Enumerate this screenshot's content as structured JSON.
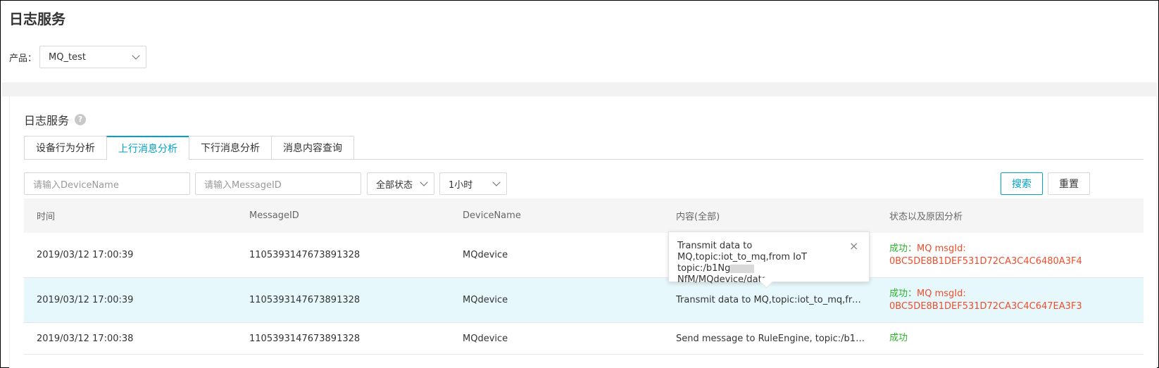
{
  "page": {
    "title": "日志服务"
  },
  "product": {
    "label": "产品：",
    "value": "MQ_test"
  },
  "panel": {
    "title": "日志服务",
    "help_icon": "?"
  },
  "tabs": [
    {
      "label": "设备行为分析"
    },
    {
      "label": "上行消息分析"
    },
    {
      "label": "下行消息分析"
    },
    {
      "label": "消息内容查询"
    }
  ],
  "filters": {
    "device_placeholder": "请输入DeviceName",
    "message_placeholder": "请输入MessageID",
    "status": "全部状态",
    "time_range": "1小时",
    "search": "搜索",
    "reset": "重置"
  },
  "table": {
    "headers": [
      "时间",
      "MessageID",
      "DeviceName",
      "内容(全部)",
      "状态以及原因分析"
    ],
    "rows": [
      {
        "time": "2019/03/12 17:00:39",
        "message_id": "1105393147673891328",
        "device": "MQdevice",
        "content": "",
        "status": "成功：",
        "status_detail": "MQ msgId:",
        "status_id": "0BC5DE8B1DEF531D72CA3C4C6480A3F4"
      },
      {
        "time": "2019/03/12 17:00:39",
        "message_id": "1105393147673891328",
        "device": "MQdevice",
        "content": "Transmit data to MQ,topic:iot_to_mq,from ...",
        "status": "成功：",
        "status_detail": "MQ msgId:",
        "status_id": "0BC5DE8B1DEF531D72CA3C4C647EA3F3"
      },
      {
        "time": "2019/03/12 17:00:38",
        "message_id": "1105393147673891328",
        "device": "MQdevice",
        "content": "Send message to RuleEngine, topic:/b1Ng...",
        "status": "成功",
        "status_detail": "",
        "status_id": ""
      }
    ]
  },
  "tooltip": {
    "line1": "Transmit data to",
    "line2": "MQ,topic:iot_to_mq,from IoT",
    "line3_prefix": "topic:/b1Ng",
    "line3_suffix": "NfM/MQdevice/data",
    "close_icon": "×"
  },
  "colors": {
    "accent": "#00a2ca",
    "success": "#2bb22b",
    "error": "#f04c2a"
  }
}
